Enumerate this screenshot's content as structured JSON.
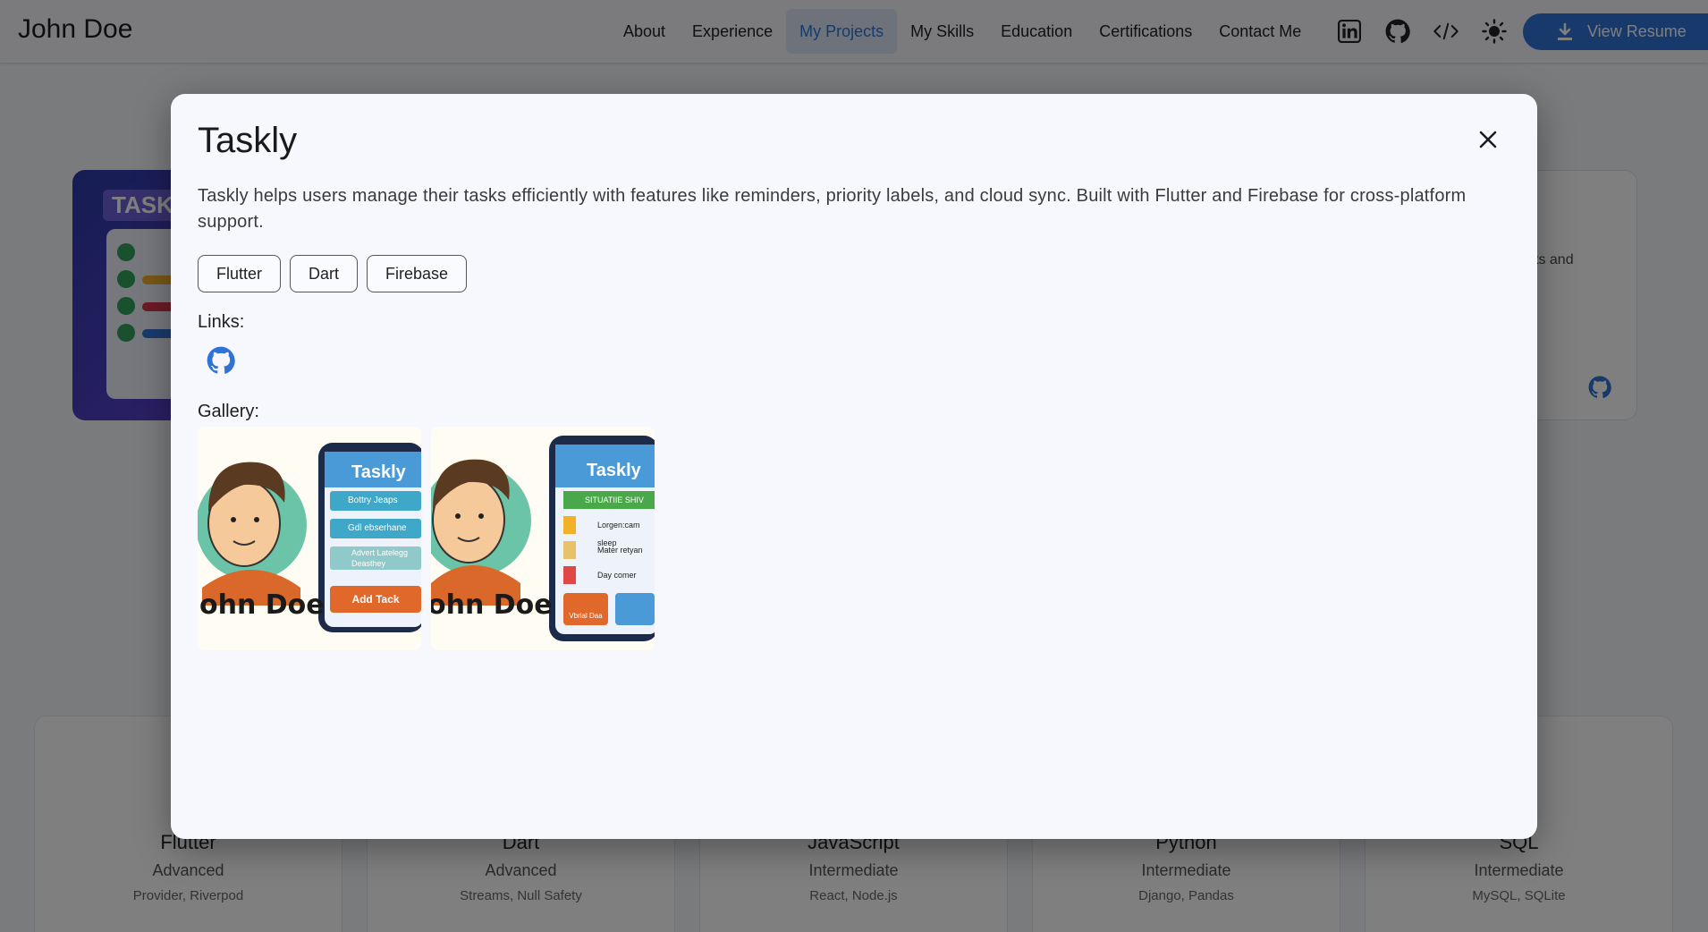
{
  "header": {
    "brand": "John Doe",
    "nav": [
      "About",
      "Experience",
      "My Projects",
      "My Skills",
      "Education",
      "Certifications",
      "Contact Me"
    ],
    "active_nav": "My Projects",
    "icons": [
      "linkedin-icon",
      "github-icon",
      "code-icon",
      "sun-icon"
    ],
    "resume_label": "View Resume"
  },
  "background": {
    "project_tag": "TASK",
    "card_text_fragment": "ts and",
    "skills": [
      {
        "name": "Flutter",
        "level": "Advanced",
        "tags": "Provider, Riverpod"
      },
      {
        "name": "Dart",
        "level": "Advanced",
        "tags": "Streams, Null Safety"
      },
      {
        "name": "JavaScript",
        "level": "Intermediate",
        "tags": "React, Node.js"
      },
      {
        "name": "Python",
        "level": "Intermediate",
        "tags": "Django, Pandas"
      },
      {
        "name": "SQL",
        "level": "Intermediate",
        "tags": "MySQL, SQLite"
      }
    ]
  },
  "modal": {
    "title": "Taskly",
    "description": "Taskly helps users manage their tasks efficiently with features like reminders, priority labels, and cloud sync. Built with Flutter and Firebase for cross-platform support.",
    "tech": [
      "Flutter",
      "Dart",
      "Firebase"
    ],
    "links_label": "Links:",
    "gallery_label": "Gallery:",
    "gallery": [
      {
        "app_name": "Taskly",
        "person_text": "ohn Doe",
        "items": [
          "Bottry Jeaps",
          "Gdl ebserhane",
          "Advert Latelegg Deasthey"
        ],
        "button": "Add Tack"
      },
      {
        "app_name": "Taskly",
        "person_text": "ohn Doe",
        "items": [
          "SITUATIIE SHIV",
          "Lorgen:cam sleep",
          "Mater retyan",
          "Day comer"
        ],
        "button": "Vbrial Daa"
      }
    ]
  }
}
